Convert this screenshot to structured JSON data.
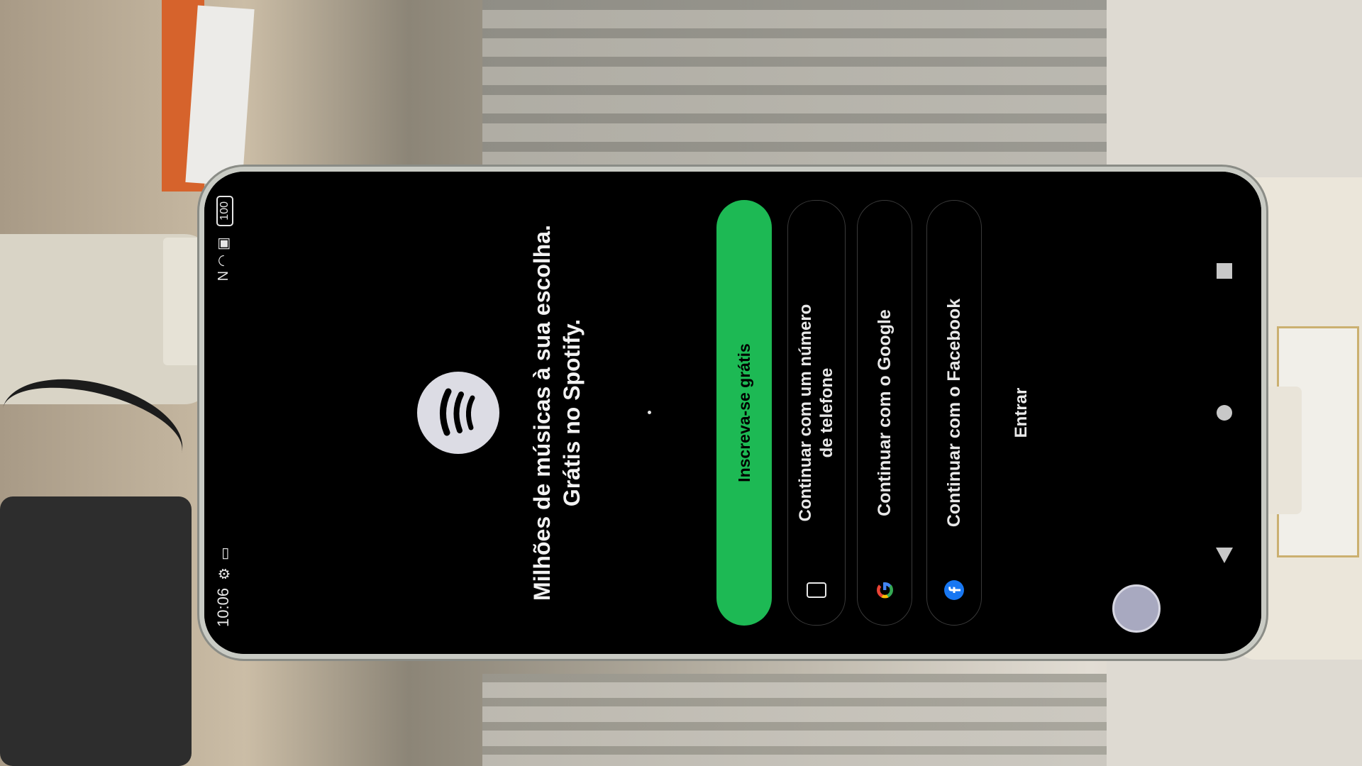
{
  "status_bar": {
    "time": "10:06",
    "battery": "100",
    "icons_left": [
      "settings-icon",
      "notification-icon"
    ],
    "icons_right": [
      "nfc-icon",
      "wifi-icon",
      "sim-icon",
      "battery-icon"
    ]
  },
  "welcome": {
    "headline_line1": "Milhões de músicas à sua escolha.",
    "headline_line2": "Grátis no Spotify."
  },
  "buttons": {
    "signup": "Inscreva-se grátis",
    "phone_line1": "Continuar com um número",
    "phone_line2": "de telefone",
    "google": "Continuar com o Google",
    "facebook": "Continuar com o Facebook",
    "login": "Entrar"
  },
  "colors": {
    "accent": "#1db954",
    "background": "#000000",
    "facebook": "#1877f2"
  },
  "nav_bar": [
    "back-icon",
    "home-icon",
    "recents-icon"
  ]
}
